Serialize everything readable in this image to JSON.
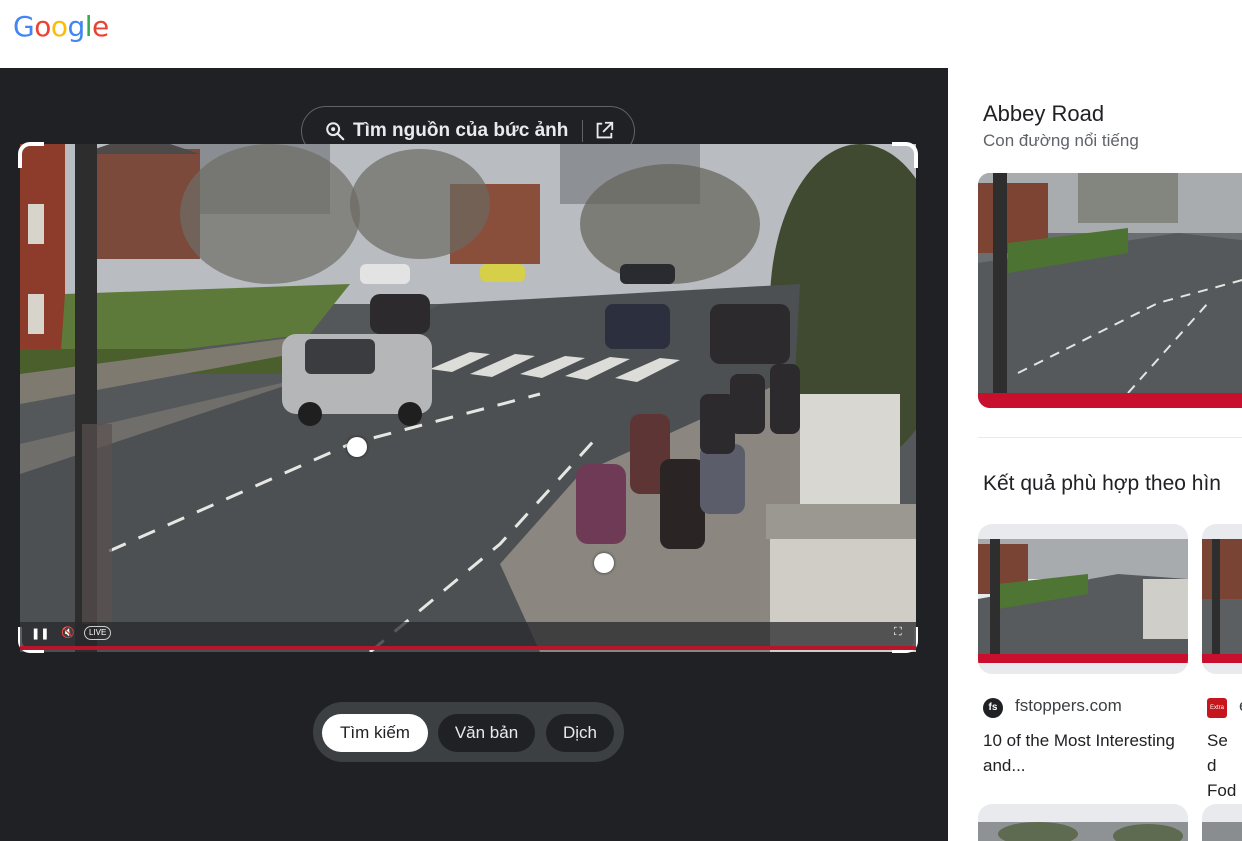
{
  "header": {
    "logo_letters": [
      "G",
      "o",
      "o",
      "g",
      "l",
      "e"
    ],
    "logo_colors": [
      "#4285f4",
      "#ea4335",
      "#fbbc05",
      "#4285f4",
      "#34a853",
      "#ea4335"
    ]
  },
  "lens": {
    "source_button_label": "Tìm nguồn của bức ảnh",
    "source_icon": "lens-search-icon",
    "external_icon": "open-in-new-icon",
    "player": {
      "live_label": "LIVE",
      "icons": [
        "pause-icon",
        "mute-icon",
        "fullscreen-icon"
      ]
    },
    "modes": [
      {
        "label": "Tìm kiếm",
        "active": true
      },
      {
        "label": "Văn bản",
        "active": false
      },
      {
        "label": "Dịch",
        "active": false
      }
    ]
  },
  "knowledge_panel": {
    "title": "Abbey Road",
    "subtitle": "Con đường nổi tiếng"
  },
  "visual_matches": {
    "heading": "Kết quả phù hợp theo hìn",
    "cards": [
      {
        "source": "fstoppers.com",
        "favicon_text": "fs",
        "favicon_color": "#202124",
        "title_lines": "10 of the Most Interesting and..."
      },
      {
        "source": "e",
        "favicon_text": "Extra",
        "favicon_color": "#c4161c",
        "title_lines": "Se d Fodg"
      }
    ]
  },
  "colors": {
    "dark_bg": "#202124",
    "accent_red": "#b7152b",
    "chip_bg": "#3c4043"
  }
}
